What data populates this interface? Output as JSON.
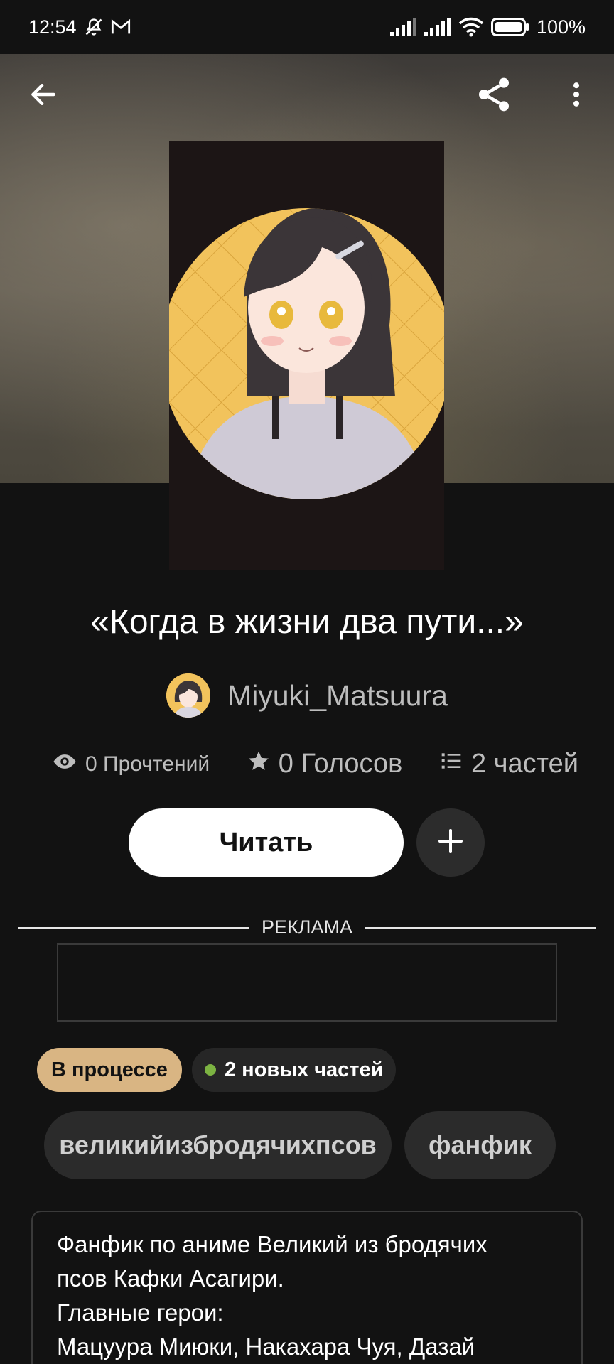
{
  "status_bar": {
    "time": "12:54",
    "battery": "100%",
    "icons": [
      "bell-off-icon",
      "gmail-icon",
      "signal-icon",
      "signal-icon",
      "wifi-icon",
      "battery-icon"
    ]
  },
  "toolbar": {
    "icons": [
      "back-arrow-icon",
      "share-icon",
      "more-vertical-icon"
    ]
  },
  "story": {
    "title": "«Когда в жизни два пути...»",
    "author": "Miyuki_Matsuura",
    "stats": {
      "reads": "0 Прочтений",
      "votes": "0 Голосов",
      "parts": "2 частей"
    },
    "read_label": "Читать"
  },
  "ad": {
    "label": "РЕКЛАМА"
  },
  "badges": {
    "status": "В процессе",
    "new_parts": "2 новых частей"
  },
  "tags": [
    "великийизбродячихпсов",
    "фанфик"
  ],
  "description": [
    "Фанфик по аниме Великий из бродячих",
    "псов Кафки Асагири.",
    "Главные герои:",
    "Мацуура Миюки, Накахара Чуя, Дазай"
  ],
  "colors": {
    "background": "#121212",
    "status_pill": "#d9b583",
    "new_dot": "#7cb342",
    "tag_bg": "#2b2b2b",
    "read_button": "#ffffff"
  }
}
